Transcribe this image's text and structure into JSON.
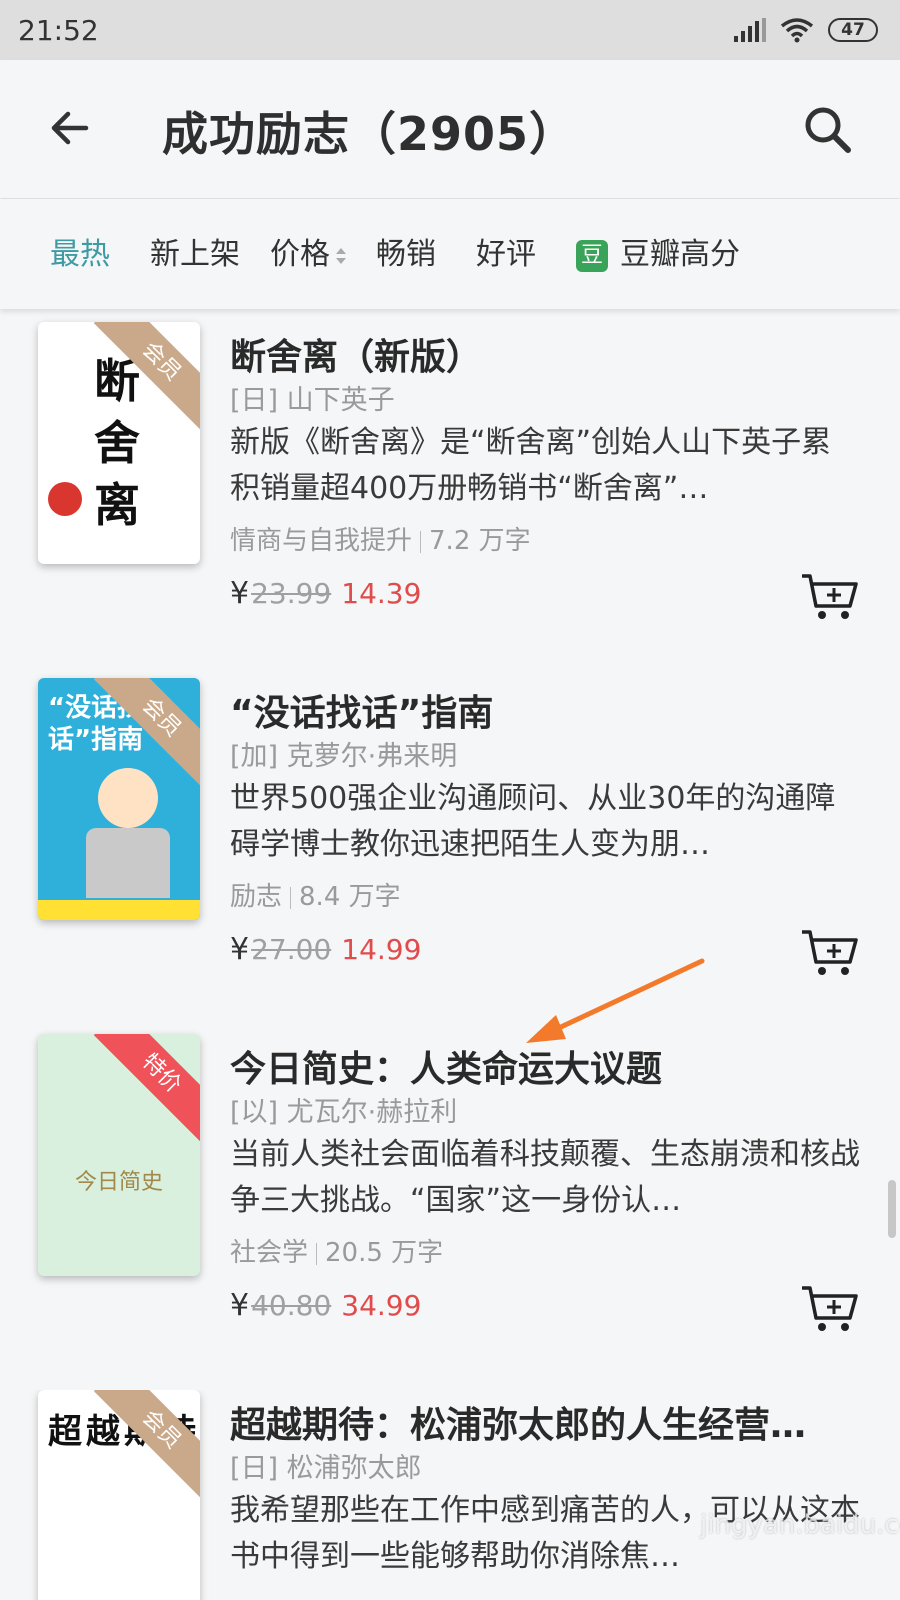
{
  "status_bar": {
    "time": "21:52",
    "battery": "47"
  },
  "header": {
    "title": "成功励志（2905）"
  },
  "filters": {
    "hot": "最热",
    "new": "新上架",
    "price": "价格",
    "bestseller": "畅销",
    "good_reviews": "好评",
    "douban_badge": "豆",
    "douban": "豆瓣高分"
  },
  "books": [
    {
      "title": "断舍离（新版）",
      "author": "[日] 山下英子",
      "desc": "新版《断舍离》是“断舍离”创始人山下英子累积销量超400万册畅销书“断舍离”…",
      "category": "情商与自我提升",
      "words": "7.2 万字",
      "yen": "¥",
      "old_price": "23.99",
      "new_price": "14.39",
      "ribbon": "会员",
      "cover_text": "断舍离"
    },
    {
      "title": "“没话找话”指南",
      "author": "[加] 克萝尔·弗来明",
      "desc": "世界500强企业沟通顾问、从业30年的沟通障碍学博士教你迅速把陌生人变为朋…",
      "category": "励志",
      "words": "8.4 万字",
      "yen": "¥",
      "old_price": "27.00",
      "new_price": "14.99",
      "ribbon": "会员",
      "cover_text": "“没话找话”指南"
    },
    {
      "title": "今日简史：人类命运大议题",
      "author": "[以] 尤瓦尔·赫拉利",
      "desc": "当前人类社会面临着科技颠覆、生态崩溃和核战争三大挑战。“国家”这一身份认…",
      "category": "社会学",
      "words": "20.5 万字",
      "yen": "¥",
      "old_price": "40.80",
      "new_price": "34.99",
      "ribbon": "特价",
      "cover_text": "今日简史"
    },
    {
      "title": "超越期待：松浦弥太郎的人生经营…",
      "author": "[日] 松浦弥太郎",
      "desc": "我希望那些在工作中感到痛苦的人，可以从这本书中得到一些能够帮助你消除焦…",
      "ribbon": "会员",
      "cover_text": "超越期待"
    }
  ],
  "watermark": "jingyan.baidu.com",
  "colors": {
    "accent": "#3e9aa3",
    "price_red": "#e04b4b",
    "ribbon_member": "#c9a98a",
    "ribbon_sale": "#f0525a",
    "arrow": "#f47a2b"
  }
}
